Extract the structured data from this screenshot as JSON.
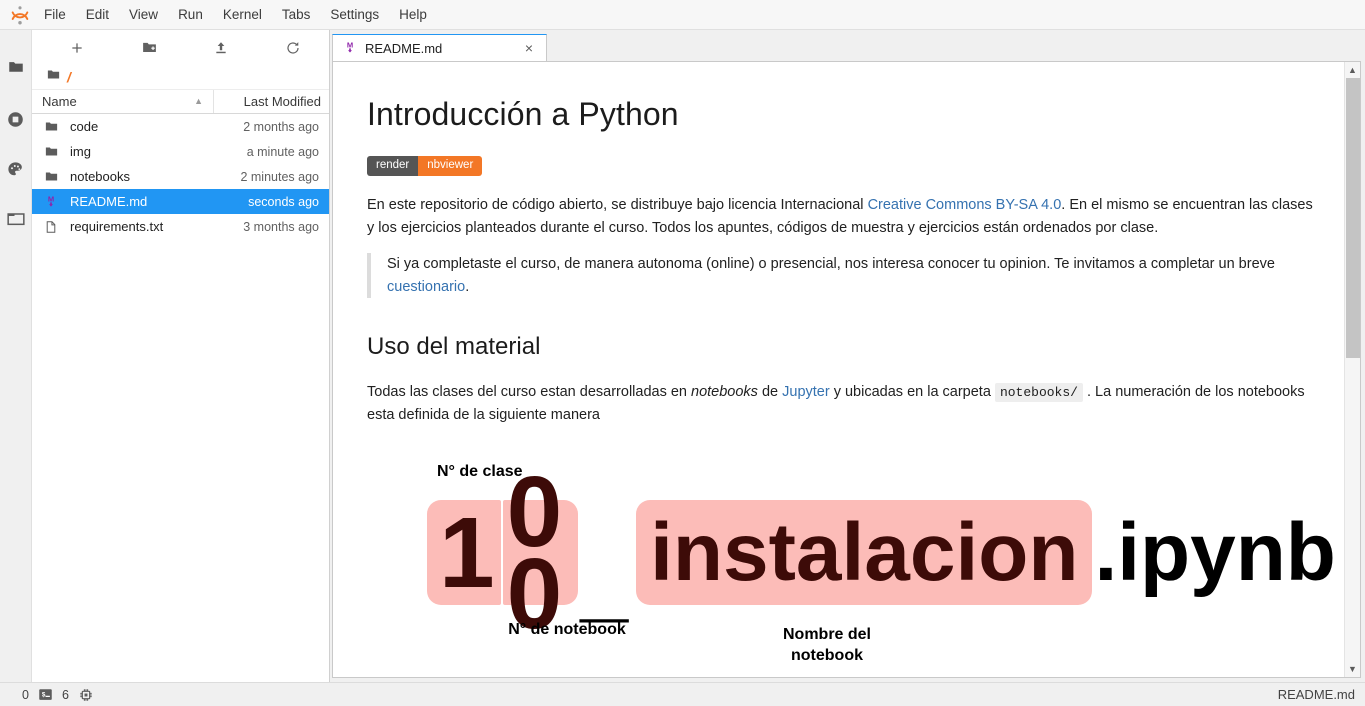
{
  "menubar": {
    "logo_icon": "jupyter-logo",
    "items": [
      {
        "label": "File"
      },
      {
        "label": "Edit"
      },
      {
        "label": "View"
      },
      {
        "label": "Run"
      },
      {
        "label": "Kernel"
      },
      {
        "label": "Tabs"
      },
      {
        "label": "Settings"
      },
      {
        "label": "Help"
      }
    ]
  },
  "activitybar": {
    "items": [
      {
        "name": "file-browser",
        "icon": "folder-icon",
        "active": true
      },
      {
        "name": "running-terminals",
        "icon": "stop-circle-icon",
        "active": false
      },
      {
        "name": "extension-manager",
        "icon": "palette-icon",
        "active": false
      },
      {
        "name": "open-tabs",
        "icon": "tab-folder-icon",
        "active": false
      }
    ]
  },
  "filebrowser": {
    "toolbar": [
      {
        "name": "new-launcher",
        "icon": "plus-icon",
        "title": "New Launcher"
      },
      {
        "name": "new-folder",
        "icon": "new-folder-icon",
        "title": "New Folder"
      },
      {
        "name": "upload",
        "icon": "upload-icon",
        "title": "Upload Files"
      },
      {
        "name": "refresh",
        "icon": "refresh-icon",
        "title": "Refresh File List"
      }
    ],
    "breadcrumb": {
      "root_icon": "folder-icon",
      "separator": "/"
    },
    "columns": {
      "name": "Name",
      "last_modified": "Last Modified",
      "sort_direction": "ascending"
    },
    "rows": [
      {
        "icon": "folder-icon",
        "name": "code",
        "modified": "2 months ago",
        "selected": false
      },
      {
        "icon": "folder-icon",
        "name": "img",
        "modified": "a minute ago",
        "selected": false
      },
      {
        "icon": "folder-icon",
        "name": "notebooks",
        "modified": "2 minutes ago",
        "selected": false
      },
      {
        "icon": "markdown-icon",
        "name": "README.md",
        "modified": "seconds ago",
        "selected": true
      },
      {
        "icon": "file-icon",
        "name": "requirements.txt",
        "modified": "3 months ago",
        "selected": false
      }
    ]
  },
  "dock": {
    "tab": {
      "icon": "markdown-icon",
      "label": "README.md",
      "close_label": "×"
    }
  },
  "document": {
    "title": "Introducción a Python",
    "badge": {
      "left_label": "render",
      "right_label": "nbviewer",
      "left_color": "#555555",
      "right_color": "#f37726"
    },
    "intro": {
      "part1": "En este repositorio de código abierto, se distribuye bajo licencia Internacional ",
      "link": "Creative Commons BY-SA 4.0",
      "part2": ". En el mismo se encuentran las clases y los ejercicios planteados durante el curso. Todos los apuntes, códigos de muestra y ejercicios están ordenados por clase."
    },
    "quote": {
      "part1": "Si ya completaste el curso, de manera autonoma (online) o presencial, nos interesa conocer tu opinion. Te invitamos a completar un breve ",
      "link": "cuestionario",
      "part2": "."
    },
    "section_title": "Uso del material",
    "usage": {
      "part1": "Todas las clases del curso estan desarrolladas en ",
      "em1": "notebooks",
      "part2": " de ",
      "link": "Jupyter",
      "part3": " y ubicadas en la carpeta ",
      "code": "notebooks/",
      "part4": " . La numeración de los notebooks esta definida de la siguiente manera"
    },
    "diagram": {
      "top_label": "N° de clase",
      "digit_class": "1",
      "digit_notebook": "0 0",
      "underscore": "_",
      "name": "instalacion",
      "extension": ".ipynb",
      "bottom_label_1": "N° de notebook",
      "bottom_label_2": "Nombre del notebook",
      "chip_color": "#fcbcb8",
      "text_color": "#3d0b08"
    }
  },
  "scrollbar": {
    "up_arrow": "▲",
    "down_arrow": "▼"
  },
  "statusbar": {
    "terminals_count": "0",
    "terminal_icon": "terminal-icon",
    "kernels_count": "6",
    "kernel_icon": "kernel-chip-icon",
    "current_file": "README.md"
  }
}
